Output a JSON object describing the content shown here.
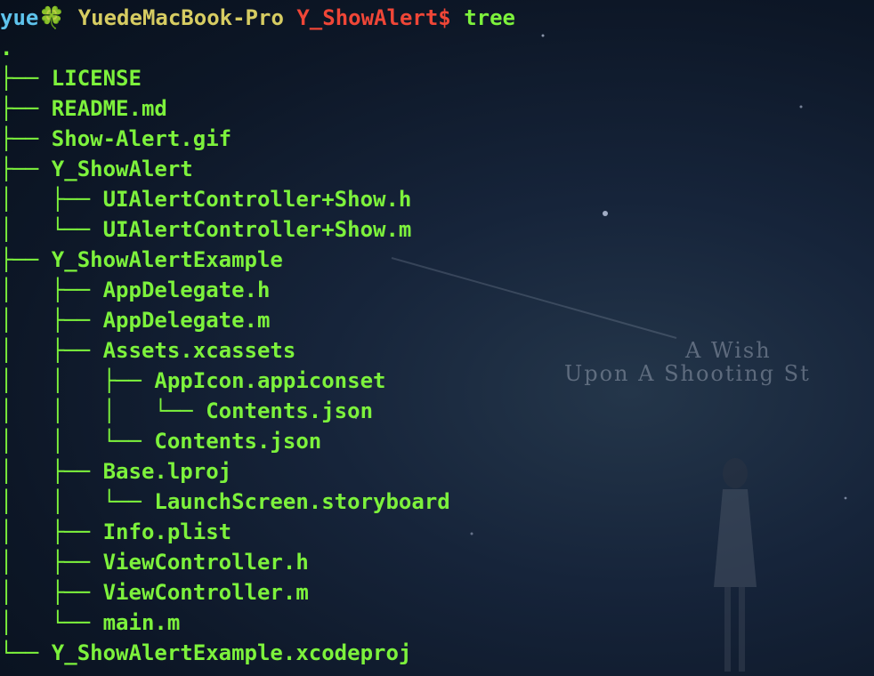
{
  "prompt": {
    "user": "yue",
    "clover_icon": "🍀",
    "host": "YuedeMacBook-Pro",
    "dir": "Y_ShowAlert$",
    "command": "tree"
  },
  "wallpaper": {
    "line1": "A Wish",
    "line2": "Upon A Shooting St"
  },
  "tree": [
    {
      "prefix": "",
      "name": "."
    },
    {
      "prefix": "├── ",
      "name": "LICENSE"
    },
    {
      "prefix": "├── ",
      "name": "README.md"
    },
    {
      "prefix": "├── ",
      "name": "Show-Alert.gif"
    },
    {
      "prefix": "├── ",
      "name": "Y_ShowAlert"
    },
    {
      "prefix": "│   ├── ",
      "name": "UIAlertController+Show.h"
    },
    {
      "prefix": "│   └── ",
      "name": "UIAlertController+Show.m"
    },
    {
      "prefix": "├── ",
      "name": "Y_ShowAlertExample"
    },
    {
      "prefix": "│   ├── ",
      "name": "AppDelegate.h"
    },
    {
      "prefix": "│   ├── ",
      "name": "AppDelegate.m"
    },
    {
      "prefix": "│   ├── ",
      "name": "Assets.xcassets"
    },
    {
      "prefix": "│   │   ├── ",
      "name": "AppIcon.appiconset"
    },
    {
      "prefix": "│   │   │   └── ",
      "name": "Contents.json"
    },
    {
      "prefix": "│   │   └── ",
      "name": "Contents.json"
    },
    {
      "prefix": "│   ├── ",
      "name": "Base.lproj"
    },
    {
      "prefix": "│   │   └── ",
      "name": "LaunchScreen.storyboard"
    },
    {
      "prefix": "│   ├── ",
      "name": "Info.plist"
    },
    {
      "prefix": "│   ├── ",
      "name": "ViewController.h"
    },
    {
      "prefix": "│   ├── ",
      "name": "ViewController.m"
    },
    {
      "prefix": "│   └── ",
      "name": "main.m"
    },
    {
      "prefix": "└── ",
      "name": "Y_ShowAlertExample.xcodeproj"
    }
  ]
}
